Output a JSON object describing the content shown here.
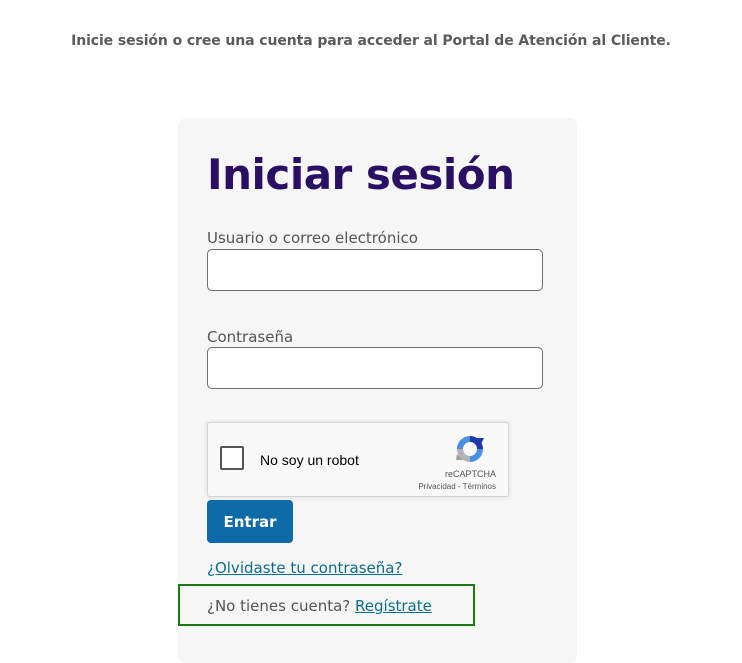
{
  "intro": {
    "text": "Inicie sesión o cree una cuenta para acceder al Portal de Atención al Cliente."
  },
  "login": {
    "title": "Iniciar sesión",
    "username_label": "Usuario o correo electrónico",
    "username_value": "",
    "password_label": "Contraseña",
    "password_value": "",
    "submit_label": "Entrar",
    "forgot_label": "¿Olvidaste tu contraseña?",
    "no_account_text": "¿No tienes cuenta?",
    "register_label": "Regístrate"
  },
  "recaptcha": {
    "label": "No soy un robot",
    "brand": "reCAPTCHA",
    "privacy": "Privacidad",
    "separator": " - ",
    "terms": "Términos",
    "checked": false
  },
  "colors": {
    "title": "#2a1065",
    "button": "#0e6ba8",
    "link": "#0a6e8f",
    "highlight_border": "#1c7a16",
    "card_background": "#f6f6f6"
  }
}
